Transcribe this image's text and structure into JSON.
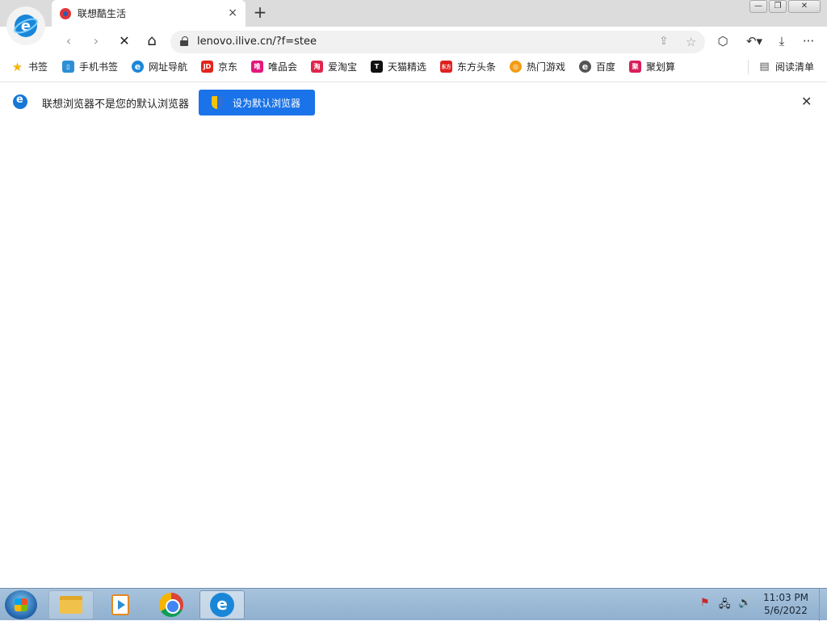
{
  "tab": {
    "title": "联想酷生活",
    "close": "×"
  },
  "new_tab": "+",
  "window_controls": {
    "minimize": "—",
    "restore": "❐",
    "close": "✕"
  },
  "toolbar": {
    "back": "‹",
    "forward": "›",
    "stop": "✕",
    "home": "⌂",
    "url": "lenovo.ilive.cn/?f=stee",
    "share": "⇪",
    "favorite": "☆",
    "extensions": "⬡",
    "undo": "↶▾",
    "download": "⤓",
    "more": "···"
  },
  "bookmarks": [
    {
      "label": "书签",
      "icon": "star-icon",
      "color": "#f4b400",
      "glyph": "★"
    },
    {
      "label": "手机书签",
      "icon": "phone-bookmark-icon",
      "color": "#2d8fd5",
      "glyph": "▯"
    },
    {
      "label": "网址导航",
      "icon": "browser-e-icon",
      "color": "#1a86d8",
      "glyph": "e"
    },
    {
      "label": "京东",
      "icon": "jd-icon",
      "color": "#e1251b",
      "glyph": "JD"
    },
    {
      "label": "唯品会",
      "icon": "vip-icon",
      "color": "#e3177b",
      "glyph": "唯"
    },
    {
      "label": "爱淘宝",
      "icon": "taobao-icon",
      "color": "#e0254d",
      "glyph": "淘"
    },
    {
      "label": "天猫精选",
      "icon": "tmall-icon",
      "color": "#111111",
      "glyph": "T"
    },
    {
      "label": "东方头条",
      "icon": "dftt-icon",
      "color": "#e02020",
      "glyph": "东方"
    },
    {
      "label": "热门游戏",
      "icon": "game-icon",
      "color": "#f39c12",
      "glyph": "◎"
    },
    {
      "label": "百度",
      "icon": "baidu-icon",
      "color": "#555555",
      "glyph": "e"
    },
    {
      "label": "聚划算",
      "icon": "juhuasuan-icon",
      "color": "#d81e5b",
      "glyph": "聚"
    }
  ],
  "reading_list": {
    "label": "阅读清单",
    "glyph": "▤"
  },
  "infobar": {
    "message": "联想浏览器不是您的默认浏览器",
    "button": "设为默认浏览器",
    "close": "✕"
  },
  "taskbar": {
    "tray": {
      "flag": "⚑",
      "network": "🖧",
      "volume": "🔊"
    },
    "time": "11:03 PM",
    "date": "5/6/2022"
  },
  "colors": {
    "accent": "#1a73e8",
    "taskbar": "#9bb8d4"
  }
}
